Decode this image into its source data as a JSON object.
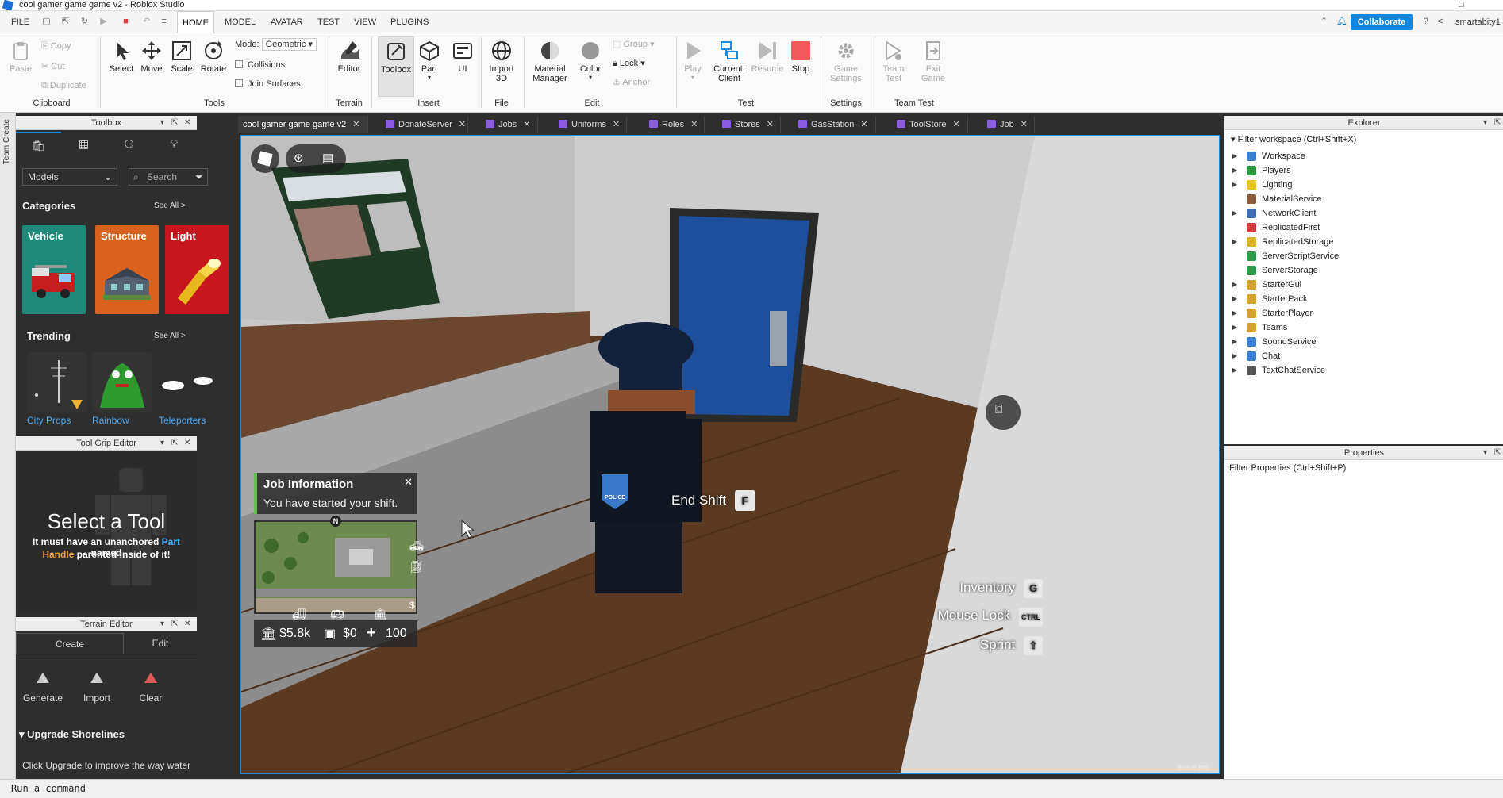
{
  "window": {
    "title": "cool gamer game game v2 - Roblox Studio",
    "maximize_glyph": "□"
  },
  "menubar": {
    "items": [
      "FILE",
      "HOME",
      "MODEL",
      "AVATAR",
      "TEST",
      "VIEW",
      "PLUGINS"
    ],
    "active": "HOME",
    "collaborate": "Collaborate",
    "username": "smartabity1"
  },
  "ribbon": {
    "clipboard": {
      "paste": "Paste",
      "copy": "Copy",
      "cut": "Cut",
      "duplicate": "Duplicate",
      "label": "Clipboard"
    },
    "tools": {
      "select": "Select",
      "move": "Move",
      "scale": "Scale",
      "rotate": "Rotate",
      "mode_label": "Mode:",
      "mode_value": "Geometric",
      "collisions": "Collisions",
      "join_surfaces": "Join Surfaces",
      "label": "Tools"
    },
    "terrain": {
      "editor": "Editor",
      "label": "Terrain"
    },
    "insert": {
      "toolbox": "Toolbox",
      "part": "Part",
      "ui": "UI",
      "label": "Insert"
    },
    "file": {
      "import_3d": [
        "Import",
        "3D"
      ],
      "label": "File"
    },
    "edit": {
      "material_manager": [
        "Material",
        "Manager"
      ],
      "color": "Color",
      "group": "Group",
      "lock": "Lock",
      "anchor": "Anchor",
      "label": "Edit"
    },
    "test": {
      "play": "Play",
      "current_client": [
        "Current:",
        "Client"
      ],
      "resume": "Resume",
      "stop": "Stop",
      "label": "Test"
    },
    "settings": {
      "game_settings": [
        "Game",
        "Settings"
      ],
      "label": "Settings"
    },
    "team_test": {
      "team_test": [
        "Team",
        "Test"
      ],
      "exit_game": [
        "Exit",
        "Game"
      ],
      "label": "Team Test"
    }
  },
  "team_create": {
    "label": "Team Create"
  },
  "toolbox": {
    "title": "Toolbox",
    "category_dropdown": "Models",
    "search_placeholder": "Search",
    "categories_title": "Categories",
    "see_all": "See All >",
    "categories": [
      {
        "label": "Vehicle",
        "color": "#1e8a7a"
      },
      {
        "label": "Structure",
        "color": "#d9621c"
      },
      {
        "label": "Light",
        "color": "#c8161e"
      }
    ],
    "trending_title": "Trending",
    "trending": [
      {
        "label": "City Props Pack"
      },
      {
        "label": "Rainbow Friends"
      },
      {
        "label": "Teleporters [WITH COOL"
      }
    ]
  },
  "tool_grip": {
    "title": "Tool Grip Editor",
    "heading": "Select a Tool",
    "line1_a": "It must have an unanchored ",
    "line1_b": "Part",
    "line1_c": " named",
    "line2_a": "Handle",
    "line2_b": " parented inside of it!"
  },
  "terrain_editor": {
    "title": "Terrain Editor",
    "tabs": [
      "Create",
      "Edit"
    ],
    "tools": [
      "Generate",
      "Import",
      "Clear"
    ],
    "section": "Upgrade Shorelines",
    "body": "Click Upgrade to improve the way water"
  },
  "doc_tabs": [
    {
      "label": "cool gamer game game v2",
      "active": true,
      "script": false
    },
    {
      "label": "DonateServer",
      "script": true
    },
    {
      "label": "Jobs",
      "script": true
    },
    {
      "label": "Uniforms",
      "script": true
    },
    {
      "label": "Roles",
      "script": true
    },
    {
      "label": "Stores",
      "script": true
    },
    {
      "label": "GasStation",
      "script": true
    },
    {
      "label": "ToolStore",
      "script": true
    },
    {
      "label": "Job",
      "script": true
    }
  ],
  "game_hud": {
    "job_info_title": "Job Information",
    "job_info_body": "You have started your shift.",
    "end_shift_label": "End Shift",
    "end_shift_key": "F",
    "compass": "N",
    "bank": "$5.8k",
    "wallet": "$0",
    "health": "100",
    "badge_text": "POLICE",
    "controls": [
      {
        "label": "Inventory",
        "key": "G"
      },
      {
        "label": "Mouse Lock",
        "key": "CTRL"
      },
      {
        "label": "Sprint",
        "key": "⇧"
      }
    ],
    "build_text": "BUILD 898"
  },
  "explorer": {
    "title": "Explorer",
    "filter": "Filter workspace (Ctrl+Shift+X)",
    "items": [
      {
        "label": "Workspace",
        "expandable": true,
        "color": "#3b7fd4"
      },
      {
        "label": "Players",
        "expandable": true,
        "color": "#2b9a3d"
      },
      {
        "label": "Lighting",
        "expandable": true,
        "color": "#e7c51b"
      },
      {
        "label": "MaterialService",
        "expandable": false,
        "color": "#8a5b3a"
      },
      {
        "label": "NetworkClient",
        "expandable": true,
        "color": "#3d6fb5"
      },
      {
        "label": "ReplicatedFirst",
        "expandable": false,
        "color": "#d33b3b"
      },
      {
        "label": "ReplicatedStorage",
        "expandable": true,
        "color": "#d8b32a"
      },
      {
        "label": "ServerScriptService",
        "expandable": false,
        "color": "#2f9a4a"
      },
      {
        "label": "ServerStorage",
        "expandable": false,
        "color": "#2f9a4a"
      },
      {
        "label": "StarterGui",
        "expandable": true,
        "color": "#d4a22b"
      },
      {
        "label": "StarterPack",
        "expandable": true,
        "color": "#d4a22b"
      },
      {
        "label": "StarterPlayer",
        "expandable": true,
        "color": "#d4a22b"
      },
      {
        "label": "Teams",
        "expandable": true,
        "color": "#d4a22b"
      },
      {
        "label": "SoundService",
        "expandable": true,
        "color": "#3b7fd4"
      },
      {
        "label": "Chat",
        "expandable": true,
        "color": "#3b7fd4"
      },
      {
        "label": "TextChatService",
        "expandable": true,
        "color": "#555555"
      }
    ]
  },
  "properties": {
    "title": "Properties",
    "filter": "Filter Properties (Ctrl+Shift+P)"
  },
  "statusbar": {
    "command": "Run a command"
  }
}
